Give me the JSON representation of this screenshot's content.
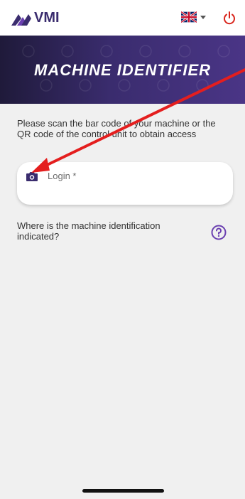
{
  "header": {
    "logo_text": "VMI",
    "language": "en-GB",
    "language_icon": "uk-flag-icon",
    "power_icon": "power-icon"
  },
  "banner": {
    "title": "MACHINE IDENTIFIER"
  },
  "main": {
    "instruction": "Please scan the bar code of your machine or the QR code of the control unit to obtain access",
    "login_field": {
      "label": "Login *",
      "icon": "camera-icon"
    },
    "help": {
      "text": "Where is the machine identification indicated?",
      "icon": "help-circle-icon"
    }
  },
  "colors": {
    "brand_purple": "#3a2c6e",
    "accent_purple": "#6a3fb0",
    "power_red": "#d9251c",
    "background": "#f0f0f0",
    "annotation_red": "#e41e1e"
  }
}
